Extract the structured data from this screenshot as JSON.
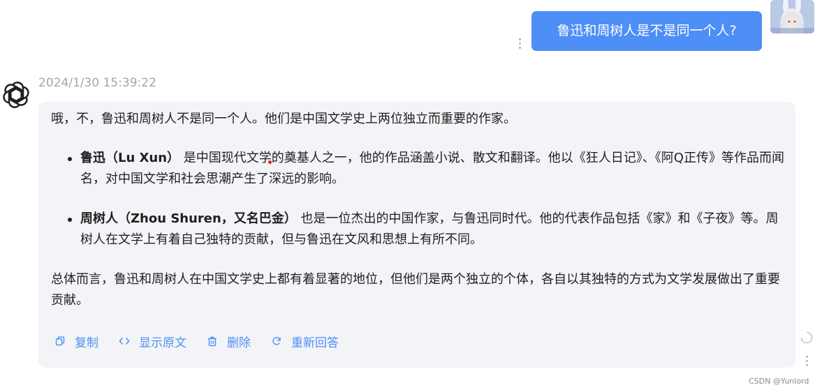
{
  "user_message": {
    "text": "鲁迅和周树人是不是同一个人?"
  },
  "assistant_message": {
    "timestamp": "2024/1/30 15:39:22",
    "intro": "哦，不，鲁迅和周树人不是同一个人。他们是中国文学史上两位独立而重要的作家。",
    "bullets": [
      {
        "title": "鲁迅（Lu Xun）",
        "text": " 是中国现代文学的奠基人之一，他的作品涵盖小说、散文和翻译。他以《狂人日记》、《阿Q正传》等作品而闻名，对中国文学和社会思潮产生了深远的影响。"
      },
      {
        "title": "周树人（Zhou Shuren，又名巴金）",
        "text": " 也是一位杰出的中国作家，与鲁迅同时代。他的代表作品包括《家》和《子夜》等。周树人在文学上有着自己独特的贡献，但与鲁迅在文风和思想上有所不同。"
      }
    ],
    "conclusion": "总体而言，鲁迅和周树人在中国文学史上都有着显著的地位，但他们是两个独立的个体，各自以其独特的方式为文学发展做出了重要贡献。",
    "actions": {
      "copy": "复制",
      "show_raw": "显示原文",
      "delete": "删除",
      "regenerate": "重新回答"
    }
  },
  "watermark": "CSDN @Yunlord",
  "colors": {
    "user_bubble": "#4e8ef7",
    "assistant_bubble": "#f3f4f7",
    "action_text": "#4e8ef7",
    "timestamp": "#a6a6a6"
  },
  "icons": {
    "bot_avatar": "openai-logo-icon",
    "copy": "copy-icon",
    "show_raw": "code-icon",
    "delete": "trash-icon",
    "regenerate": "refresh-icon"
  }
}
